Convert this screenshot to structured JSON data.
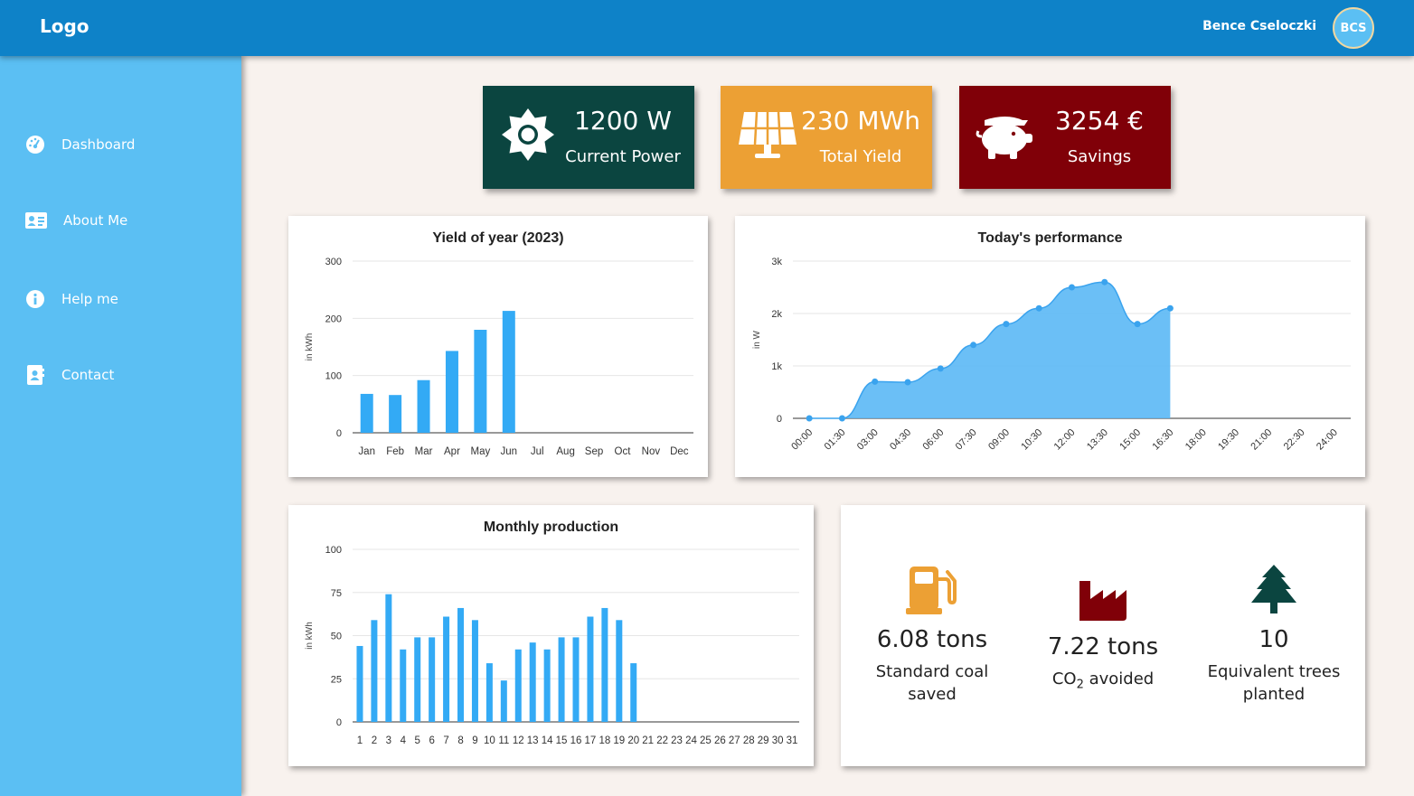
{
  "header": {
    "logo": "Logo",
    "user_name": "Bence Cseloczki",
    "avatar_initials": "BCS"
  },
  "sidebar": {
    "items": [
      {
        "label": "Dashboard",
        "icon": "gauge-icon"
      },
      {
        "label": "About Me",
        "icon": "id-card-icon"
      },
      {
        "label": "Help me",
        "icon": "info-icon"
      },
      {
        "label": "Contact",
        "icon": "contact-book-icon"
      }
    ]
  },
  "stats": [
    {
      "value": "1200 W",
      "label": "Current Power",
      "color": "#0b4540",
      "icon": "sun-icon"
    },
    {
      "value": "230 MWh",
      "label": "Total Yield",
      "color": "#eca034",
      "icon": "solar-panel-icon"
    },
    {
      "value": "3254 €",
      "label": "Savings",
      "color": "#800008",
      "icon": "piggy-bank-icon"
    }
  ],
  "charts": {
    "yearly": {
      "title": "Yield of year (2023)"
    },
    "today": {
      "title": "Today's performance"
    },
    "monthly": {
      "title": "Monthly production"
    }
  },
  "chart_data": [
    {
      "type": "bar",
      "title": "Yield of year (2023)",
      "ylabel": "in kWh",
      "ylim": [
        0,
        300
      ],
      "yticks": [
        "0",
        "100",
        "200",
        "300"
      ],
      "categories": [
        "Jan",
        "Feb",
        "Mar",
        "Apr",
        "May",
        "Jun",
        "Jul",
        "Aug",
        "Sep",
        "Oct",
        "Nov",
        "Dec"
      ],
      "values": [
        68,
        66,
        92,
        143,
        180,
        213,
        null,
        null,
        null,
        null,
        null,
        null
      ],
      "color": "#33aaf5"
    },
    {
      "type": "area",
      "title": "Today's performance",
      "ylabel": "in W",
      "ylim": [
        0,
        3000
      ],
      "yticks": [
        "0",
        "1k",
        "2k",
        "3k"
      ],
      "x": [
        "00:00",
        "01:30",
        "03:00",
        "04:30",
        "06:00",
        "07:30",
        "09:00",
        "10:30",
        "12:00",
        "13:30",
        "15:00",
        "16:30",
        "18:00",
        "19:30",
        "21:00",
        "22:30",
        "24:00"
      ],
      "values": [
        0,
        0,
        700,
        690,
        950,
        1400,
        1800,
        2100,
        2500,
        2600,
        1800,
        2100
      ],
      "color": "#5bb8f5"
    },
    {
      "type": "bar",
      "title": "Monthly production",
      "ylabel": "in kWh",
      "ylim": [
        0,
        100
      ],
      "yticks": [
        "0",
        "25",
        "50",
        "75",
        "100"
      ],
      "categories": [
        "1",
        "2",
        "3",
        "4",
        "5",
        "6",
        "7",
        "8",
        "9",
        "10",
        "11",
        "12",
        "13",
        "14",
        "15",
        "16",
        "17",
        "18",
        "19",
        "20",
        "21",
        "22",
        "23",
        "24",
        "25",
        "26",
        "27",
        "28",
        "29",
        "30",
        "31"
      ],
      "values": [
        44,
        59,
        74,
        42,
        49,
        49,
        61,
        66,
        59,
        34,
        24,
        42,
        46,
        42,
        49,
        49,
        61,
        66,
        59,
        34,
        null,
        null,
        null,
        null,
        null,
        null,
        null,
        null,
        null,
        null,
        null
      ],
      "color": "#33aaf5"
    }
  ],
  "impact": [
    {
      "value": "6.08 tons",
      "label_lines": [
        "Standard coal",
        "saved"
      ],
      "icon": "fuel-pump-icon",
      "color": "#eca034"
    },
    {
      "value": "7.22 tons",
      "label_prefix": "CO",
      "label_sub": "2",
      "label_suffix": " avoided",
      "icon": "factory-icon",
      "color": "#800008"
    },
    {
      "value": "10",
      "label_lines": [
        "Equivalent trees",
        "planted"
      ],
      "icon": "tree-icon",
      "color": "#0b4540"
    }
  ]
}
